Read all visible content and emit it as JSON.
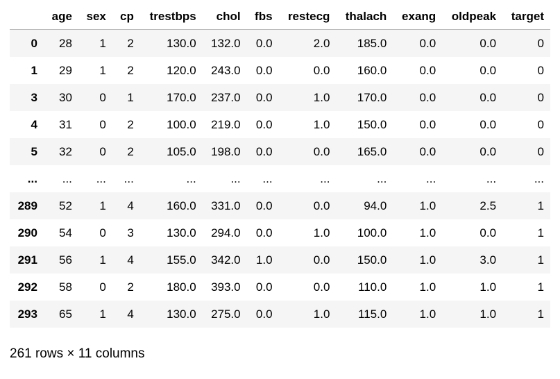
{
  "dataframe": {
    "columns": [
      "",
      "age",
      "sex",
      "cp",
      "trestbps",
      "chol",
      "fbs",
      "restecg",
      "thalach",
      "exang",
      "oldpeak",
      "target"
    ],
    "rows": [
      {
        "index": "0",
        "cells": [
          "28",
          "1",
          "2",
          "130.0",
          "132.0",
          "0.0",
          "2.0",
          "185.0",
          "0.0",
          "0.0",
          "0"
        ]
      },
      {
        "index": "1",
        "cells": [
          "29",
          "1",
          "2",
          "120.0",
          "243.0",
          "0.0",
          "0.0",
          "160.0",
          "0.0",
          "0.0",
          "0"
        ]
      },
      {
        "index": "3",
        "cells": [
          "30",
          "0",
          "1",
          "170.0",
          "237.0",
          "0.0",
          "1.0",
          "170.0",
          "0.0",
          "0.0",
          "0"
        ]
      },
      {
        "index": "4",
        "cells": [
          "31",
          "0",
          "2",
          "100.0",
          "219.0",
          "0.0",
          "1.0",
          "150.0",
          "0.0",
          "0.0",
          "0"
        ]
      },
      {
        "index": "5",
        "cells": [
          "32",
          "0",
          "2",
          "105.0",
          "198.0",
          "0.0",
          "0.0",
          "165.0",
          "0.0",
          "0.0",
          "0"
        ]
      },
      {
        "index": "...",
        "cells": [
          "...",
          "...",
          "...",
          "...",
          "...",
          "...",
          "...",
          "...",
          "...",
          "...",
          "..."
        ]
      },
      {
        "index": "289",
        "cells": [
          "52",
          "1",
          "4",
          "160.0",
          "331.0",
          "0.0",
          "0.0",
          "94.0",
          "1.0",
          "2.5",
          "1"
        ]
      },
      {
        "index": "290",
        "cells": [
          "54",
          "0",
          "3",
          "130.0",
          "294.0",
          "0.0",
          "1.0",
          "100.0",
          "1.0",
          "0.0",
          "1"
        ]
      },
      {
        "index": "291",
        "cells": [
          "56",
          "1",
          "4",
          "155.0",
          "342.0",
          "1.0",
          "0.0",
          "150.0",
          "1.0",
          "3.0",
          "1"
        ]
      },
      {
        "index": "292",
        "cells": [
          "58",
          "0",
          "2",
          "180.0",
          "393.0",
          "0.0",
          "0.0",
          "110.0",
          "1.0",
          "1.0",
          "1"
        ]
      },
      {
        "index": "293",
        "cells": [
          "65",
          "1",
          "4",
          "130.0",
          "275.0",
          "0.0",
          "1.0",
          "115.0",
          "1.0",
          "1.0",
          "1"
        ]
      }
    ],
    "shape_text": "261 rows × 11 columns"
  }
}
